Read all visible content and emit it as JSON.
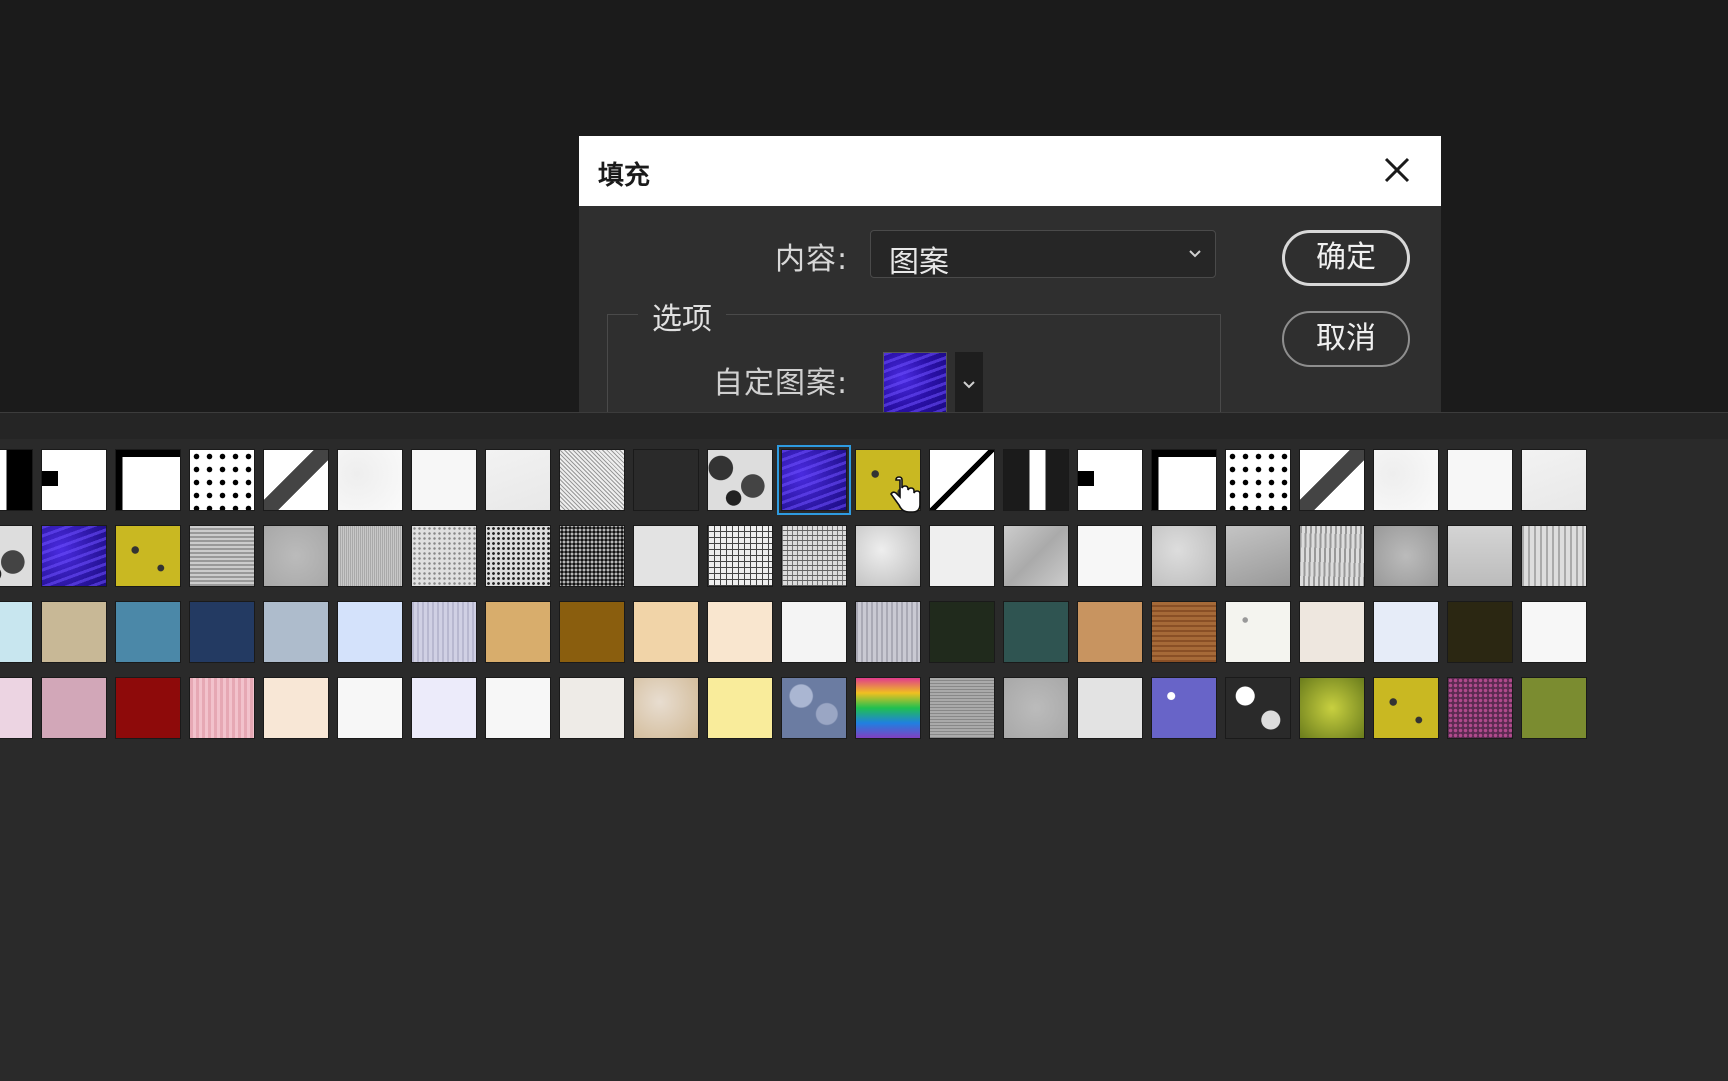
{
  "dialog": {
    "title": "填充",
    "content_label": "内容:",
    "content_value": "图案",
    "ok_label": "确定",
    "cancel_label": "取消",
    "options_label": "选项",
    "custom_pattern_label": "自定图案:"
  },
  "icons": {
    "close": "close-icon",
    "dropdown": "chevron-down-icon",
    "cursor": "hand-pointer-icon"
  },
  "picker": {
    "rows": [
      [
        "black-white-split",
        "black-bar-white",
        "black-corner-white",
        "dot-grid",
        "diagonal-pixels",
        "white-speckle",
        "white-plain",
        "white-light-gray",
        "black-white-noise",
        "concentric-squares",
        "camo-gray",
        "blue-purple-wave",
        "yellow-sponge",
        "diagonal-line",
        "black-white-bar-v",
        "black-bar-white",
        "black-corner-white",
        "dot-grid",
        "diagonal-pixels",
        "white-speckle",
        "white-plain",
        "white-light-gray"
      ],
      [
        "camo-gray",
        "blue-purple-wave",
        "yellow-sponge",
        "gray-weave",
        "gray-noise",
        "gray-fine-noise",
        "gray-speckle",
        "black-speckle",
        "black-dense-speckle",
        "light-gray-noise",
        "mesh-grid",
        "woven-gray",
        "gray-marble",
        "white-soft",
        "gray-crumple",
        "white-plain",
        "gray-stucco",
        "gray-rough",
        "gray-bark",
        "gray-mottle",
        "light-gray-smooth",
        "gray-streak"
      ],
      [
        "light-blue",
        "tan",
        "steel-blue",
        "navy-denim",
        "blue-gray-paper",
        "pale-blue",
        "lavender-lines",
        "sand",
        "ochre-dark",
        "peach",
        "cream",
        "white-paper",
        "gray-lines",
        "dark-green",
        "teal-granite",
        "light-brown",
        "brown-wood",
        "white-flecks",
        "cream-light",
        "pale-blue-light",
        "dark-olive",
        "white-plain"
      ],
      [
        "pink-pale",
        "dusty-pink",
        "dark-red",
        "pink-stripes",
        "cream-peach",
        "white-plain",
        "lavender-pale",
        "white-plain",
        "off-white",
        "sand-marble",
        "pale-yellow",
        "blue-bubbles",
        "rainbow",
        "gray-fabric",
        "gray-noise",
        "light-gray-noise",
        "blue-flowers",
        "black-white-rocks",
        "green-moss",
        "yellow-sponge",
        "purple-gravel",
        "olive-moss"
      ]
    ],
    "selected_row": 0,
    "selected_col": 11
  }
}
